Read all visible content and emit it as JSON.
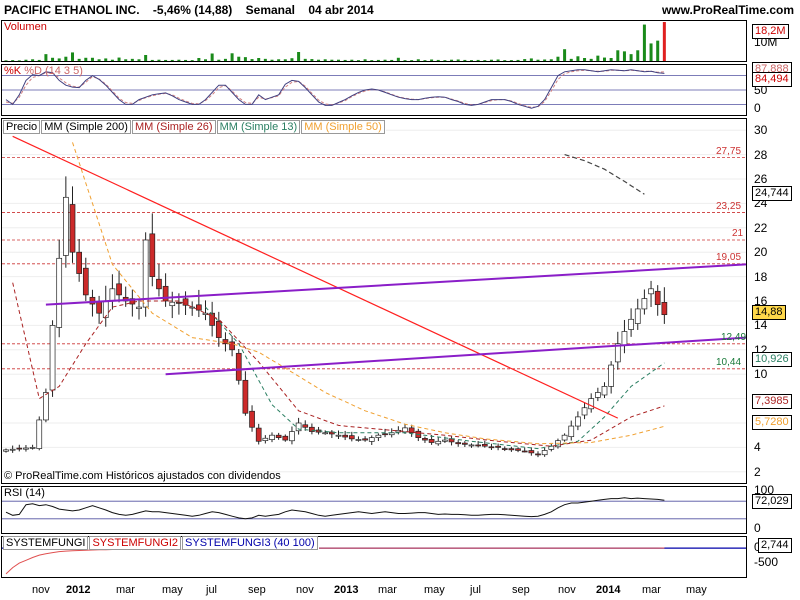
{
  "header": {
    "instrument": "PACIFIC ETHANOL INC.",
    "change": "-5,46% (14,88)",
    "period": "Semanal",
    "date": "04 abr 2014",
    "website": "www.ProRealTime.com"
  },
  "panels": {
    "volume": {
      "label": "Volumen",
      "ticks": [
        "10M"
      ],
      "last": "18,2M"
    },
    "stoch": {
      "label_k": "%K",
      "label_d": "%D (14 3 5)",
      "ticks": [
        "50",
        "0"
      ],
      "last_k": "84,494",
      "last_d": "87,888"
    },
    "price": {
      "legend": [
        "Precio",
        "MM (Simple 200)",
        "MM (Simple 26)",
        "MM (Simple 13)",
        "MM (Simple 50)"
      ],
      "ticks": [
        "30",
        "28",
        "26",
        "24",
        "22",
        "20",
        "18",
        "16",
        "14",
        "12",
        "10",
        "8",
        "6",
        "4",
        "2"
      ],
      "last": "14,88",
      "ma200": "24,744",
      "ma13": "10,926",
      "ma26": "7,3985",
      "ma50": "5,7280",
      "copyright": "© ProRealTime.com Históricos ajustados con dividendos"
    },
    "rsi": {
      "label": "RSI (14)",
      "ticks": [
        "100",
        "0"
      ],
      "last": "72,029"
    },
    "system": {
      "labels": [
        "SYSTEMFUNGI",
        "SYSTEMFUNGI2",
        "SYSTEMFUNGI3 (40 100)"
      ],
      "ticks": [
        "0",
        "-500"
      ],
      "last": "2,744"
    }
  },
  "colors": {
    "ma200": "#444444",
    "ma26": "#aa2222",
    "ma13": "#2a7f62",
    "ma50": "#f0a030",
    "trend": "#ff2020",
    "channel": "#8a1ec8",
    "bull": "#ffffff",
    "bear": "#cc2a2a",
    "levels": "#cc3333"
  },
  "chart_data": {
    "type": "candlestick",
    "xlabels": [
      "nov",
      "2012",
      "mar",
      "may",
      "jul",
      "sep",
      "nov",
      "2013",
      "mar",
      "may",
      "jul",
      "sep",
      "nov",
      "2014",
      "mar",
      "may"
    ],
    "price_ylim": [
      1,
      31
    ],
    "levels": [
      {
        "label": "27,75",
        "value": 27.75
      },
      {
        "label": "23,25",
        "value": 23.25
      },
      {
        "label": "21",
        "value": 21
      },
      {
        "label": "19,05",
        "value": 19.05
      },
      {
        "label": "12,49",
        "value": 12.49
      },
      {
        "label": "10,44",
        "value": 10.44
      }
    ],
    "price_anchors": [
      [
        0,
        3.8
      ],
      [
        4,
        4.0
      ],
      [
        6,
        8.5
      ],
      [
        8,
        19.5
      ],
      [
        9,
        24.5
      ],
      [
        10,
        20.0
      ],
      [
        12,
        16.5
      ],
      [
        14,
        15.0
      ],
      [
        16,
        17.0
      ],
      [
        18,
        16.0
      ],
      [
        20,
        15.5
      ],
      [
        21,
        21.0
      ],
      [
        22,
        18.0
      ],
      [
        24,
        16.0
      ],
      [
        26,
        15.8
      ],
      [
        28,
        15.5
      ],
      [
        30,
        15.0
      ],
      [
        32,
        13.0
      ],
      [
        34,
        12.0
      ],
      [
        35,
        9.5
      ],
      [
        36,
        6.8
      ],
      [
        38,
        4.5
      ],
      [
        40,
        5.0
      ],
      [
        42,
        4.6
      ],
      [
        44,
        6.0
      ],
      [
        46,
        5.3
      ],
      [
        48,
        5.2
      ],
      [
        50,
        5.0
      ],
      [
        52,
        4.7
      ],
      [
        54,
        4.6
      ],
      [
        56,
        5.0
      ],
      [
        58,
        5.2
      ],
      [
        60,
        5.6
      ],
      [
        62,
        4.8
      ],
      [
        64,
        4.4
      ],
      [
        66,
        4.6
      ],
      [
        68,
        4.3
      ],
      [
        70,
        4.2
      ],
      [
        72,
        4.1
      ],
      [
        74,
        4.0
      ],
      [
        76,
        3.8
      ],
      [
        78,
        3.7
      ],
      [
        80,
        3.4
      ],
      [
        82,
        4.1
      ],
      [
        84,
        5.0
      ],
      [
        86,
        6.5
      ],
      [
        88,
        8.0
      ],
      [
        90,
        9.0
      ],
      [
        92,
        12.5
      ],
      [
        94,
        14.5
      ],
      [
        96,
        16.2
      ],
      [
        97,
        17.0
      ],
      [
        98,
        15.7
      ],
      [
        99,
        14.88
      ]
    ],
    "ma13_anchors": [
      [
        30,
        15.5
      ],
      [
        35,
        12.5
      ],
      [
        40,
        7.5
      ],
      [
        44,
        5.5
      ],
      [
        50,
        5.2
      ],
      [
        60,
        5.2
      ],
      [
        70,
        4.5
      ],
      [
        80,
        3.9
      ],
      [
        86,
        4.5
      ],
      [
        90,
        6.5
      ],
      [
        94,
        9.0
      ],
      [
        99,
        10.926
      ]
    ],
    "ma26_anchors": [
      [
        1,
        17.5
      ],
      [
        5,
        8.0
      ],
      [
        8,
        9.0
      ],
      [
        12,
        12.5
      ],
      [
        16,
        15.5
      ],
      [
        20,
        16.0
      ],
      [
        26,
        16.0
      ],
      [
        32,
        14.5
      ],
      [
        38,
        11.0
      ],
      [
        44,
        7.0
      ],
      [
        50,
        5.8
      ],
      [
        58,
        5.4
      ],
      [
        66,
        5.0
      ],
      [
        74,
        4.5
      ],
      [
        82,
        4.1
      ],
      [
        88,
        4.6
      ],
      [
        94,
        6.5
      ],
      [
        99,
        7.3985
      ]
    ],
    "ma50_anchors": [
      [
        10,
        29.0
      ],
      [
        16,
        19.0
      ],
      [
        22,
        15.0
      ],
      [
        28,
        13.0
      ],
      [
        34,
        12.5
      ],
      [
        38,
        11.8
      ],
      [
        42,
        10.5
      ],
      [
        48,
        8.5
      ],
      [
        54,
        7.0
      ],
      [
        60,
        5.9
      ],
      [
        66,
        5.2
      ],
      [
        72,
        4.7
      ],
      [
        80,
        4.3
      ],
      [
        88,
        4.4
      ],
      [
        94,
        5.0
      ],
      [
        99,
        5.728
      ]
    ],
    "ma200_anchors": [
      [
        84,
        28.0
      ],
      [
        87,
        27.5
      ],
      [
        90,
        26.8
      ],
      [
        93,
        25.8
      ],
      [
        96,
        24.744
      ]
    ],
    "trend_line": [
      [
        1,
        29.5
      ],
      [
        92,
        6.4
      ]
    ],
    "channel_upper": [
      [
        6,
        15.7
      ],
      [
        99,
        19.0
      ]
    ],
    "channel_lower": [
      [
        24,
        10.0
      ],
      [
        99,
        13.0
      ]
    ],
    "volume_max": 18.2,
    "volume": [
      0.3,
      0.4,
      0.3,
      0.6,
      0.8,
      0.5,
      3.2,
      1.5,
      1.2,
      2.0,
      4.0,
      1.0,
      1.5,
      1.5,
      0.8,
      1.2,
      0.6,
      1.6,
      0.8,
      1.0,
      0.8,
      2.8,
      0.5,
      0.6,
      0.5,
      0.5,
      0.6,
      0.5,
      0.4,
      1.4,
      0.8,
      3.5,
      0.6,
      1.0,
      3.6,
      2.0,
      1.8,
      0.9,
      1.4,
      1.0,
      0.6,
      0.8,
      0.8,
      1.3,
      4.2,
      1.0,
      0.9,
      0.6,
      0.8,
      0.6,
      0.6,
      0.5,
      0.6,
      0.4,
      0.8,
      0.4,
      0.5,
      0.6,
      0.5,
      1.5,
      0.4,
      0.4,
      0.8,
      0.4,
      0.7,
      0.5,
      0.4,
      0.6,
      0.7,
      0.5,
      0.4,
      0.5,
      0.4,
      0.6,
      0.7,
      0.4,
      0.4,
      0.5,
      0.9,
      1.2,
      0.6,
      0.7,
      0.8,
      2.0,
      5.5,
      1.0,
      2.2,
      1.4,
      1.0,
      2.5,
      1.6,
      1.4,
      5.0,
      4.5,
      3.2,
      5.0,
      17.0,
      8.2,
      9.5,
      18.2
    ],
    "stoch_k": [
      30,
      20,
      40,
      70,
      82,
      80,
      88,
      86,
      70,
      60,
      56,
      55,
      70,
      80,
      72,
      60,
      45,
      30,
      20,
      20,
      30,
      35,
      40,
      42,
      44,
      38,
      30,
      25,
      20,
      20,
      30,
      45,
      60,
      60,
      45,
      30,
      20,
      20,
      40,
      30,
      35,
      40,
      62,
      70,
      68,
      55,
      40,
      25,
      18,
      18,
      24,
      30,
      38,
      45,
      50,
      52,
      50,
      45,
      40,
      35,
      32,
      30,
      30,
      33,
      35,
      36,
      35,
      30,
      26,
      20,
      18,
      20,
      25,
      30,
      30,
      30,
      26,
      20,
      16,
      12,
      16,
      30,
      55,
      80,
      88,
      90,
      92,
      92,
      90,
      88,
      90,
      92,
      91,
      90,
      92,
      90,
      88,
      89,
      86,
      84.494
    ],
    "stoch_d": [
      25,
      22,
      35,
      60,
      76,
      80,
      86,
      86,
      75,
      65,
      58,
      56,
      66,
      78,
      73,
      62,
      48,
      33,
      24,
      22,
      28,
      34,
      38,
      41,
      43,
      40,
      33,
      27,
      22,
      21,
      28,
      40,
      55,
      59,
      48,
      34,
      24,
      22,
      35,
      31,
      34,
      38,
      56,
      66,
      68,
      58,
      43,
      29,
      21,
      19,
      23,
      28,
      36,
      43,
      48,
      51,
      50,
      46,
      41,
      36,
      33,
      31,
      30,
      32,
      34,
      35,
      35,
      31,
      27,
      22,
      19,
      20,
      24,
      28,
      30,
      30,
      27,
      22,
      17,
      14,
      15,
      26,
      48,
      72,
      84,
      88,
      90,
      91,
      90,
      89,
      89,
      91,
      91,
      90,
      91,
      90,
      89,
      89,
      87,
      87.888
    ],
    "rsi": [
      45,
      38,
      40,
      62,
      64,
      60,
      62,
      58,
      52,
      50,
      48,
      50,
      55,
      60,
      55,
      50,
      44,
      40,
      38,
      40,
      44,
      48,
      46,
      46,
      44,
      42,
      40,
      38,
      36,
      38,
      42,
      46,
      44,
      40,
      36,
      32,
      30,
      32,
      38,
      36,
      38,
      40,
      46,
      50,
      48,
      46,
      42,
      38,
      36,
      38,
      40,
      42,
      44,
      46,
      44,
      42,
      44,
      46,
      44,
      42,
      42,
      43,
      44,
      44,
      42,
      40,
      41,
      40,
      40,
      39,
      38,
      38,
      39,
      40,
      40,
      39,
      38,
      37,
      36,
      35,
      36,
      40,
      46,
      55,
      62,
      66,
      66,
      68,
      70,
      72,
      74,
      76,
      76,
      78,
      76,
      77,
      76,
      75,
      74,
      72.029
    ],
    "system": [
      -740,
      -560,
      -430,
      -350,
      -270,
      -200,
      -160,
      -130,
      -100,
      -85,
      -75,
      -70,
      -60,
      -55,
      -50,
      -45,
      -40,
      -38,
      -35,
      -33,
      -30,
      -28,
      -26,
      -24,
      -22,
      -20,
      -18,
      -17,
      -15,
      -14,
      -13,
      -12,
      -11,
      -10,
      -9,
      -8,
      -7,
      -6,
      -5,
      -5,
      -4,
      -4,
      -3,
      -3,
      -2,
      -2,
      -2,
      -1,
      -1,
      -1,
      0,
      0,
      0,
      0,
      0,
      0,
      0,
      0,
      0,
      0,
      0,
      0,
      0,
      0,
      0,
      0,
      0,
      0,
      0,
      0,
      0,
      0,
      0,
      0,
      0,
      0,
      0,
      0,
      0,
      0,
      0,
      0,
      0,
      0,
      0,
      0,
      0,
      0,
      0,
      0,
      0,
      0,
      0,
      0,
      0,
      0,
      0,
      0,
      0,
      2.744
    ]
  }
}
